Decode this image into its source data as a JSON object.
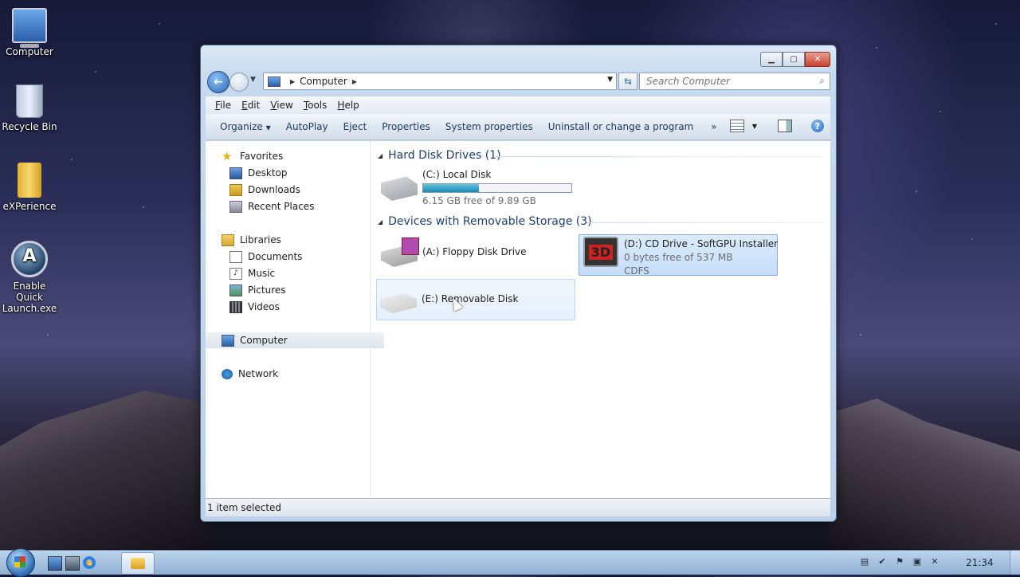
{
  "desktop": {
    "icons": [
      {
        "label": "Computer"
      },
      {
        "label": "Recycle Bin"
      },
      {
        "label": "eXPerience"
      },
      {
        "label": "Enable Quick Launch.exe"
      }
    ]
  },
  "window": {
    "address": {
      "segment": "Computer"
    },
    "search": {
      "placeholder": "Search Computer"
    },
    "menu": [
      "File",
      "Edit",
      "View",
      "Tools",
      "Help"
    ],
    "commands": [
      "Organize",
      "AutoPlay",
      "Eject",
      "Properties",
      "System properties",
      "Uninstall or change a program",
      "»"
    ],
    "nav": {
      "favorites": "Favorites",
      "desktop": "Desktop",
      "downloads": "Downloads",
      "recent_places": "Recent Places",
      "libraries": "Libraries",
      "documents": "Documents",
      "music": "Music",
      "pictures": "Pictures",
      "videos": "Videos",
      "computer": "Computer",
      "network": "Network"
    },
    "groups": {
      "hard_disks": {
        "title": "Hard Disk Drives (1)",
        "drives": [
          {
            "name": "(C:) Local Disk",
            "free_text": "6.15 GB free of 9.89 GB",
            "used_fraction": 0.378
          }
        ]
      },
      "removable": {
        "title": "Devices with Removable Storage (3)",
        "drives": [
          {
            "name": "(A:) Floppy Disk Drive"
          },
          {
            "name": "(D:) CD Drive - SoftGPU Installer",
            "free_text": "0 bytes free of 537 MB",
            "fs": "CDFS",
            "icon_text": "3D"
          },
          {
            "name": "(E:) Removable Disk"
          }
        ]
      }
    },
    "status": "1 item selected"
  },
  "taskbar": {
    "clock": "21:34"
  }
}
